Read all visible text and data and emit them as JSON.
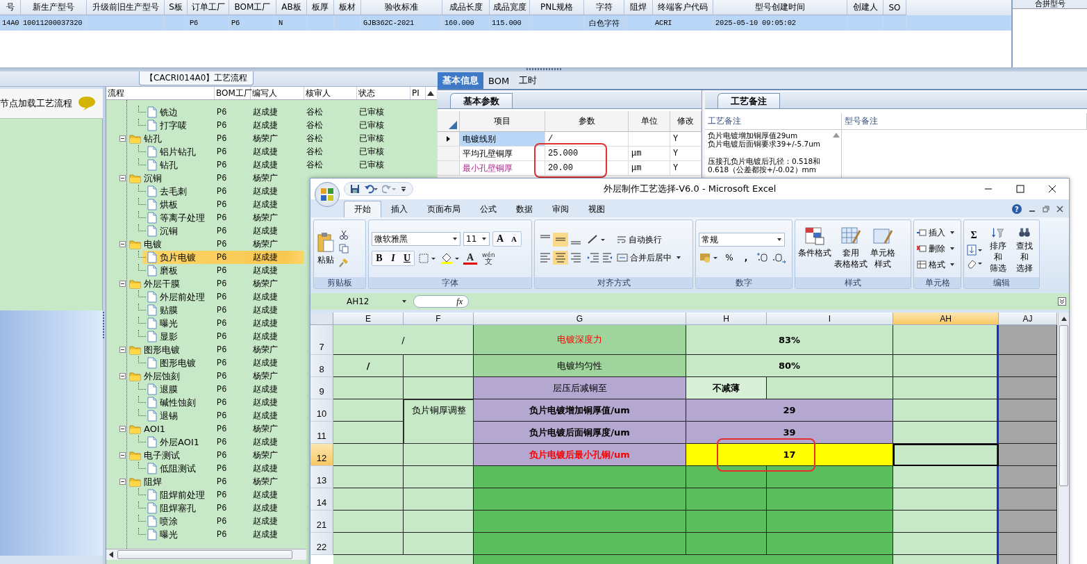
{
  "data_table": {
    "row_selected": true,
    "columns": [
      {
        "label": "号",
        "value": "14A0"
      },
      {
        "label": "新生产型号",
        "value": "10011200037320"
      },
      {
        "label": "升级前旧生产型号"
      },
      {
        "label": "S板"
      },
      {
        "label": "订单工厂",
        "value": "P6"
      },
      {
        "label": "BOM工厂",
        "value": "P6"
      },
      {
        "label": "AB板",
        "value": "N"
      },
      {
        "label": "板厚"
      },
      {
        "label": "板材"
      },
      {
        "label": "验收标准",
        "value": "GJB362C-2021"
      },
      {
        "label": "成品长度",
        "value": "160.000"
      },
      {
        "label": "成品宽度",
        "value": "115.000"
      },
      {
        "label": "PNL规格"
      },
      {
        "label": "字符",
        "value": "白色字符"
      },
      {
        "label": "阻焊"
      },
      {
        "label": "终端客户代码",
        "value": "ACRI"
      },
      {
        "label": "型号创建时间",
        "value": "2025-05-10 09:05:02"
      },
      {
        "label": "创建人"
      },
      {
        "label": "SO"
      }
    ]
  },
  "merge_panel": {
    "header": "合拼型号"
  },
  "node_panel": {
    "title": "节点加载工艺流程"
  },
  "process_flow": {
    "title": "【CACRI014A0】工艺流程",
    "columns": [
      "流程",
      "BOM工厂",
      "编写人",
      "核审人",
      "状态",
      "PI"
    ],
    "nodes": [
      {
        "children": [
          {
            "label": "铣边",
            "kind": "file",
            "bom": "P6",
            "writer": "赵成捷",
            "reviewer": "谷松",
            "status": "已审核",
            "selected": false
          },
          {
            "label": "打字唛",
            "kind": "file",
            "bom": "P6",
            "writer": "赵成捷",
            "reviewer": "谷松",
            "status": "已审核",
            "selected": false
          }
        ]
      },
      {
        "label": "钻孔",
        "kind": "folder",
        "expanded": true,
        "bom": "P6",
        "writer": "杨荣广",
        "reviewer": "谷松",
        "status": "已审核",
        "selected": false,
        "children": [
          {
            "label": "铝片钻孔",
            "kind": "file",
            "bom": "P6",
            "writer": "赵成捷",
            "reviewer": "谷松",
            "status": "已审核",
            "selected": false
          },
          {
            "label": "钻孔",
            "kind": "file",
            "bom": "P6",
            "writer": "赵成捷",
            "reviewer": "谷松",
            "status": "已审核",
            "selected": false
          }
        ]
      },
      {
        "label": "沉铜",
        "kind": "folder",
        "expanded": true,
        "bom": "P6",
        "writer": "杨荣广",
        "selected": false,
        "children": [
          {
            "label": "去毛刺",
            "kind": "file",
            "bom": "P6",
            "writer": "赵成捷",
            "selected": false
          },
          {
            "label": "烘板",
            "kind": "file",
            "bom": "P6",
            "writer": "赵成捷",
            "selected": false
          },
          {
            "label": "等离子处理",
            "kind": "file",
            "bom": "P6",
            "writer": "杨荣广",
            "selected": false
          },
          {
            "label": "沉铜",
            "kind": "file",
            "bom": "P6",
            "writer": "赵成捷",
            "selected": false
          }
        ]
      },
      {
        "label": "电镀",
        "kind": "folder",
        "expanded": true,
        "bom": "P6",
        "writer": "杨荣广",
        "selected": false,
        "children": [
          {
            "label": "负片电镀",
            "kind": "file",
            "bom": "P6",
            "writer": "赵成捷",
            "selected": true
          },
          {
            "label": "磨板",
            "kind": "file",
            "bom": "P6",
            "writer": "赵成捷",
            "selected": false
          }
        ]
      },
      {
        "label": "外层干膜",
        "kind": "folder",
        "expanded": true,
        "bom": "P6",
        "writer": "杨荣广",
        "selected": false,
        "children": [
          {
            "label": "外层前处理",
            "kind": "file",
            "bom": "P6",
            "writer": "赵成捷",
            "selected": false
          },
          {
            "label": "贴膜",
            "kind": "file",
            "bom": "P6",
            "writer": "赵成捷",
            "selected": false
          },
          {
            "label": "曝光",
            "kind": "file",
            "bom": "P6",
            "writer": "赵成捷",
            "selected": false
          },
          {
            "label": "显影",
            "kind": "file",
            "bom": "P6",
            "writer": "赵成捷",
            "selected": false
          }
        ]
      },
      {
        "label": "图形电镀",
        "kind": "folder",
        "expanded": true,
        "bom": "P6",
        "writer": "杨荣广",
        "selected": false,
        "children": [
          {
            "label": "图形电镀",
            "kind": "file",
            "bom": "P6",
            "writer": "赵成捷",
            "selected": false
          }
        ]
      },
      {
        "label": "外层蚀刻",
        "kind": "folder",
        "expanded": true,
        "bom": "P6",
        "writer": "杨荣广",
        "selected": false,
        "children": [
          {
            "label": "退膜",
            "kind": "file",
            "bom": "P6",
            "writer": "赵成捷",
            "selected": false
          },
          {
            "label": "碱性蚀刻",
            "kind": "file",
            "bom": "P6",
            "writer": "赵成捷",
            "selected": false
          },
          {
            "label": "退锡",
            "kind": "file",
            "bom": "P6",
            "writer": "赵成捷",
            "selected": false
          }
        ]
      },
      {
        "label": "AOI1",
        "kind": "folder",
        "expanded": true,
        "bom": "P6",
        "writer": "杨荣广",
        "selected": false,
        "children": [
          {
            "label": "外层AOI1",
            "kind": "file",
            "bom": "P6",
            "writer": "赵成捷",
            "selected": false
          }
        ]
      },
      {
        "label": "电子测试",
        "kind": "folder",
        "expanded": true,
        "bom": "P6",
        "writer": "杨荣广",
        "selected": false,
        "children": [
          {
            "label": "低阻测试",
            "kind": "file",
            "bom": "P6",
            "writer": "赵成捷",
            "selected": false
          }
        ]
      },
      {
        "label": "阻焊",
        "kind": "folder",
        "expanded": true,
        "bom": "P6",
        "writer": "杨荣广",
        "selected": false,
        "children": [
          {
            "label": "阻焊前处理",
            "kind": "file",
            "bom": "P6",
            "writer": "赵成捷",
            "selected": false
          },
          {
            "label": "阻焊塞孔",
            "kind": "file",
            "bom": "P6",
            "writer": "赵成捷",
            "selected": false
          },
          {
            "label": "喷涂",
            "kind": "file",
            "bom": "P6",
            "writer": "赵成捷",
            "selected": false
          },
          {
            "label": "曝光",
            "kind": "file",
            "bom": "P6",
            "writer": "赵成捷",
            "selected": false
          }
        ]
      }
    ]
  },
  "detail_tabs": [
    {
      "label": "基本信息",
      "selected": true
    },
    {
      "label": "BOM",
      "selected": false
    },
    {
      "label": "工时",
      "selected": false
    }
  ],
  "basic_params": {
    "tab": "基本参数",
    "columns": [
      "项目",
      "参数",
      "单位",
      "修改"
    ],
    "rows": [
      {
        "item": "电镀线别",
        "value": "/",
        "modify": "Y",
        "current": true,
        "kind": "plain"
      },
      {
        "item": "平均孔壁铜厚",
        "value": "25.000",
        "unit": "μm",
        "modify": "Y",
        "current": false,
        "kind": "plain"
      },
      {
        "item": "最小孔壁铜厚",
        "value": "20.00",
        "unit": "μm",
        "modify": "Y",
        "current": false,
        "kind": "highlighted"
      }
    ]
  },
  "process_notes": {
    "tab": "工艺备注",
    "columns": [
      "工艺备注",
      "型号备注"
    ],
    "paragraphs": [
      [
        "负片电镀增加铜厚值29um",
        "负片电镀后面铜要求39+/-5.7um"
      ],
      [
        "压接孔负片电镀后孔径：0.518和0.618（公差都按+/-0.02）mm"
      ]
    ]
  },
  "excel": {
    "title": "外层制作工艺选择-V6.0 - Microsoft Excel",
    "help": "?",
    "ribbon_tabs": [
      {
        "label": "开始",
        "selected": true
      },
      {
        "label": "插入",
        "selected": false
      },
      {
        "label": "页面布局",
        "selected": false
      },
      {
        "label": "公式",
        "selected": false
      },
      {
        "label": "数据",
        "selected": false
      },
      {
        "label": "审阅",
        "selected": false
      },
      {
        "label": "视图",
        "selected": false
      }
    ],
    "clipboard": {
      "paste": "粘贴",
      "group": "剪贴板"
    },
    "font": {
      "name": "微软雅黑",
      "size": "11",
      "grow": "A",
      "shrink": "A",
      "bold": "B",
      "italic": "I",
      "underline": "U",
      "color_button": "A",
      "phonetic": [
        "wén",
        "文"
      ],
      "group": "字体"
    },
    "alignment": {
      "wrap": "自动换行",
      "merge": "合并后居中",
      "group": "对齐方式"
    },
    "number": {
      "format": "常规",
      "percent": "%",
      "comma": ",",
      "group": "数字"
    },
    "styles": {
      "buttons": [
        [
          "条件格式"
        ],
        [
          "套用",
          "表格格式"
        ],
        [
          "单元格",
          "样式"
        ]
      ],
      "group": "样式"
    },
    "cells": {
      "buttons": [
        "插入",
        "删除",
        "格式"
      ],
      "group": "单元格"
    },
    "editing": {
      "sum": "Σ",
      "buttons": [
        [
          "排序和",
          "筛选"
        ],
        [
          "查找和",
          "选择"
        ]
      ],
      "group": "编辑"
    },
    "name_box": "AH12",
    "fx": "fx",
    "columns": [
      {
        "label": "E",
        "selected": false
      },
      {
        "label": "F",
        "selected": false
      },
      {
        "label": "G",
        "selected": false
      },
      {
        "label": "H",
        "selected": false
      },
      {
        "label": "I",
        "selected": false
      },
      {
        "label": "AH",
        "selected": true
      },
      {
        "label": "AJ",
        "selected": false
      }
    ],
    "rows": [
      {
        "header": "7",
        "selected": false,
        "cells": [
          {
            "kind": "light",
            "wide": true,
            "text": "/"
          },
          {
            "kind": "mid",
            "text": "电镀深度力",
            "emphasis": true
          },
          {
            "kind": "light",
            "wide": true,
            "text": "83%",
            "bold": true
          },
          {
            "kind": "light"
          },
          {
            "kind": "gray"
          }
        ]
      },
      {
        "header": "8",
        "selected": false,
        "cells": [
          {
            "kind": "light",
            "text": "/",
            "bold": true
          },
          {
            "kind": "light"
          },
          {
            "kind": "mid",
            "text": "电镀均匀性"
          },
          {
            "kind": "light",
            "wide": true,
            "text": "80%",
            "bold": true
          },
          {
            "kind": "light"
          },
          {
            "kind": "gray"
          }
        ]
      },
      {
        "header": "9",
        "selected": false,
        "cells": [
          {
            "kind": "light"
          },
          {
            "kind": "light"
          },
          {
            "kind": "purple",
            "text": "层压后减铜至"
          },
          {
            "kind": "pale",
            "text": "不减薄",
            "bold": true
          },
          {
            "kind": "light"
          },
          {
            "kind": "light"
          },
          {
            "kind": "gray"
          }
        ]
      },
      {
        "header": "10",
        "selected": false,
        "cells": [
          {
            "kind": "light"
          },
          {
            "kind": "light",
            "tall": true,
            "text": "负片铜厚调整"
          },
          {
            "kind": "purple",
            "text": "负片电镀增加铜厚值/um",
            "bold": true
          },
          {
            "kind": "purple",
            "wide": true,
            "text": "29",
            "bold": true
          },
          {
            "kind": "light"
          },
          {
            "kind": "gray"
          }
        ]
      },
      {
        "header": "11",
        "selected": false,
        "cells": [
          {
            "kind": "light"
          },
          {
            "kind": "purple",
            "text": "负片电镀后面铜厚度/um",
            "bold": true
          },
          {
            "kind": "purple",
            "wide": true,
            "text": "39",
            "bold": true
          },
          {
            "kind": "light"
          },
          {
            "kind": "gray"
          }
        ]
      },
      {
        "header": "12",
        "selected": true,
        "cells": [
          {
            "kind": "light"
          },
          {
            "kind": "light"
          },
          {
            "kind": "purple",
            "text": "负片电镀后最小孔铜/um",
            "bold": true,
            "emphasis": true
          },
          {
            "kind": "yellow",
            "wide": true,
            "text": "17",
            "bold": true
          },
          {
            "kind": "light"
          },
          {
            "kind": "gray"
          }
        ]
      },
      {
        "header": "13",
        "selected": false,
        "cells": [
          {
            "kind": "light"
          },
          {
            "kind": "light"
          },
          {
            "kind": "dark"
          },
          {
            "kind": "dark"
          },
          {
            "kind": "dark"
          },
          {
            "kind": "light"
          },
          {
            "kind": "gray"
          }
        ]
      },
      {
        "header": "14",
        "selected": false,
        "cells": [
          {
            "kind": "light"
          },
          {
            "kind": "light"
          },
          {
            "kind": "dark"
          },
          {
            "kind": "dark"
          },
          {
            "kind": "dark"
          },
          {
            "kind": "light"
          },
          {
            "kind": "gray"
          }
        ]
      },
      {
        "header": "21",
        "selected": false,
        "cells": [
          {
            "kind": "light"
          },
          {
            "kind": "light"
          },
          {
            "kind": "dark"
          },
          {
            "kind": "dark"
          },
          {
            "kind": "dark"
          },
          {
            "kind": "light"
          },
          {
            "kind": "gray"
          }
        ]
      },
      {
        "header": "22",
        "selected": false,
        "cells": [
          {
            "kind": "light"
          },
          {
            "kind": "light"
          },
          {
            "kind": "dark"
          },
          {
            "kind": "dark"
          },
          {
            "kind": "dark"
          },
          {
            "kind": "light"
          },
          {
            "kind": "gray"
          }
        ]
      }
    ]
  }
}
